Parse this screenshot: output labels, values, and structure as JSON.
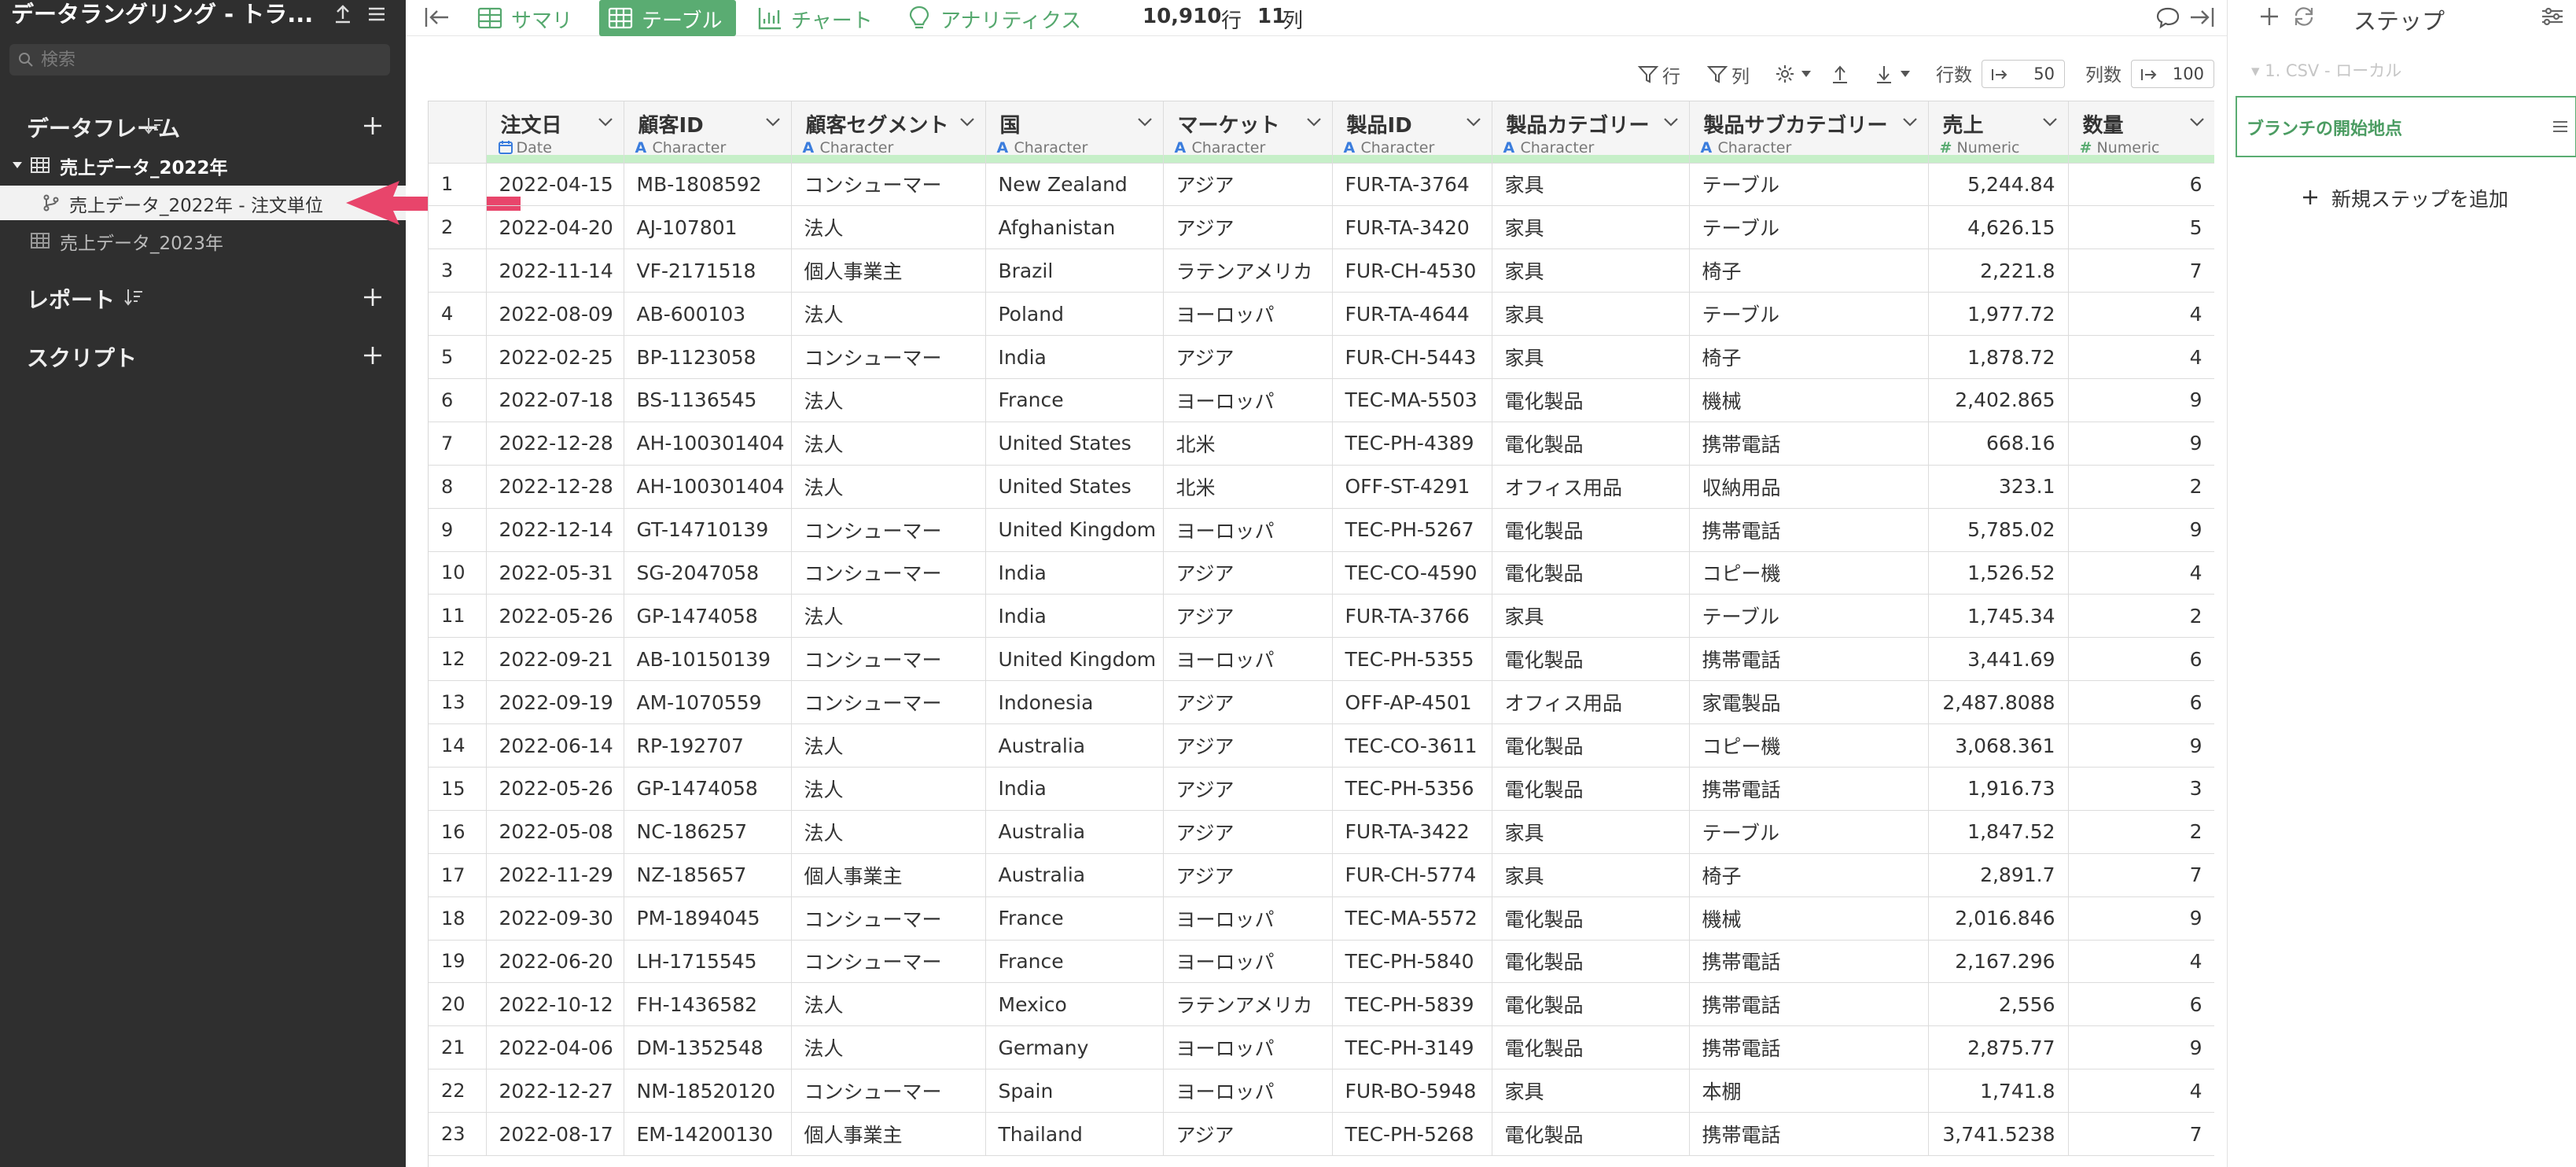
{
  "sidebar": {
    "title": "データラングリング - トラ...",
    "search_placeholder": "検索",
    "sections": {
      "dataframes": "データフレーム",
      "reports": "レポート",
      "scripts": "スクリプト"
    },
    "items": {
      "df1": "売上データ_2022年",
      "branch": "売上データ_2022年 - 注文単位",
      "df2": "売上データ_2023年"
    }
  },
  "topbar": {
    "tabs": {
      "summary": "サマリ",
      "table": "テーブル",
      "chart": "チャート",
      "analytics": "アナリティクス"
    },
    "rows_count": "10,910",
    "rows_unit": "行",
    "cols_count": "11",
    "cols_unit": "列"
  },
  "toolbar": {
    "row_filter": "行",
    "col_filter": "列",
    "rows_label": "行数",
    "rows_value": "50",
    "cols_label": "列数",
    "cols_value": "100"
  },
  "table": {
    "columns": [
      {
        "name": "注文日",
        "type": "Date"
      },
      {
        "name": "顧客ID",
        "type": "Character"
      },
      {
        "name": "顧客セグメント",
        "type": "Character"
      },
      {
        "name": "国",
        "type": "Character"
      },
      {
        "name": "マーケット",
        "type": "Character"
      },
      {
        "name": "製品ID",
        "type": "Character"
      },
      {
        "name": "製品カテゴリー",
        "type": "Character"
      },
      {
        "name": "製品サブカテゴリー",
        "type": "Character"
      },
      {
        "name": "売上",
        "type": "Numeric"
      },
      {
        "name": "数量",
        "type": "Numeric"
      }
    ],
    "rows": [
      [
        "1",
        "2022-04-15",
        "MB-1808592",
        "コンシューマー",
        "New Zealand",
        "アジア",
        "FUR-TA-3764",
        "家具",
        "テーブル",
        "5,244.84",
        "6"
      ],
      [
        "2",
        "2022-04-20",
        "AJ-107801",
        "法人",
        "Afghanistan",
        "アジア",
        "FUR-TA-3420",
        "家具",
        "テーブル",
        "4,626.15",
        "5"
      ],
      [
        "3",
        "2022-11-14",
        "VF-2171518",
        "個人事業主",
        "Brazil",
        "ラテンアメリカ",
        "FUR-CH-4530",
        "家具",
        "椅子",
        "2,221.8",
        "7"
      ],
      [
        "4",
        "2022-08-09",
        "AB-600103",
        "法人",
        "Poland",
        "ヨーロッパ",
        "FUR-TA-4644",
        "家具",
        "テーブル",
        "1,977.72",
        "4"
      ],
      [
        "5",
        "2022-02-25",
        "BP-1123058",
        "コンシューマー",
        "India",
        "アジア",
        "FUR-CH-5443",
        "家具",
        "椅子",
        "1,878.72",
        "4"
      ],
      [
        "6",
        "2022-07-18",
        "BS-1136545",
        "法人",
        "France",
        "ヨーロッパ",
        "TEC-MA-5503",
        "電化製品",
        "機械",
        "2,402.865",
        "9"
      ],
      [
        "7",
        "2022-12-28",
        "AH-100301404",
        "法人",
        "United States",
        "北米",
        "TEC-PH-4389",
        "電化製品",
        "携帯電話",
        "668.16",
        "9"
      ],
      [
        "8",
        "2022-12-28",
        "AH-100301404",
        "法人",
        "United States",
        "北米",
        "OFF-ST-4291",
        "オフィス用品",
        "収納用品",
        "323.1",
        "2"
      ],
      [
        "9",
        "2022-12-14",
        "GT-14710139",
        "コンシューマー",
        "United Kingdom",
        "ヨーロッパ",
        "TEC-PH-5267",
        "電化製品",
        "携帯電話",
        "5,785.02",
        "9"
      ],
      [
        "10",
        "2022-05-31",
        "SG-2047058",
        "コンシューマー",
        "India",
        "アジア",
        "TEC-CO-4590",
        "電化製品",
        "コピー機",
        "1,526.52",
        "4"
      ],
      [
        "11",
        "2022-05-26",
        "GP-1474058",
        "法人",
        "India",
        "アジア",
        "FUR-TA-3766",
        "家具",
        "テーブル",
        "1,745.34",
        "2"
      ],
      [
        "12",
        "2022-09-21",
        "AB-10150139",
        "コンシューマー",
        "United Kingdom",
        "ヨーロッパ",
        "TEC-PH-5355",
        "電化製品",
        "携帯電話",
        "3,441.69",
        "6"
      ],
      [
        "13",
        "2022-09-19",
        "AM-1070559",
        "コンシューマー",
        "Indonesia",
        "アジア",
        "OFF-AP-4501",
        "オフィス用品",
        "家電製品",
        "2,487.8088",
        "6"
      ],
      [
        "14",
        "2022-06-14",
        "RP-192707",
        "法人",
        "Australia",
        "アジア",
        "TEC-CO-3611",
        "電化製品",
        "コピー機",
        "3,068.361",
        "9"
      ],
      [
        "15",
        "2022-05-26",
        "GP-1474058",
        "法人",
        "India",
        "アジア",
        "TEC-PH-5356",
        "電化製品",
        "携帯電話",
        "1,916.73",
        "3"
      ],
      [
        "16",
        "2022-05-08",
        "NC-186257",
        "法人",
        "Australia",
        "アジア",
        "FUR-TA-3422",
        "家具",
        "テーブル",
        "1,847.52",
        "2"
      ],
      [
        "17",
        "2022-11-29",
        "NZ-185657",
        "個人事業主",
        "Australia",
        "アジア",
        "FUR-CH-5774",
        "家具",
        "椅子",
        "2,891.7",
        "7"
      ],
      [
        "18",
        "2022-09-30",
        "PM-1894045",
        "コンシューマー",
        "France",
        "ヨーロッパ",
        "TEC-MA-5572",
        "電化製品",
        "機械",
        "2,016.846",
        "9"
      ],
      [
        "19",
        "2022-06-20",
        "LH-1715545",
        "コンシューマー",
        "France",
        "ヨーロッパ",
        "TEC-PH-5840",
        "電化製品",
        "携帯電話",
        "2,167.296",
        "4"
      ],
      [
        "20",
        "2022-10-12",
        "FH-1436582",
        "法人",
        "Mexico",
        "ラテンアメリカ",
        "TEC-PH-5839",
        "電化製品",
        "携帯電話",
        "2,556",
        "6"
      ],
      [
        "21",
        "2022-04-06",
        "DM-1352548",
        "法人",
        "Germany",
        "ヨーロッパ",
        "TEC-PH-3149",
        "電化製品",
        "携帯電話",
        "2,875.77",
        "9"
      ],
      [
        "22",
        "2022-12-27",
        "NM-18520120",
        "コンシューマー",
        "Spain",
        "ヨーロッパ",
        "FUR-BO-5948",
        "家具",
        "本棚",
        "1,741.8",
        "4"
      ],
      [
        "23",
        "2022-08-17",
        "EM-14200130",
        "個人事業主",
        "Thailand",
        "アジア",
        "TEC-PH-5268",
        "電化製品",
        "携帯電話",
        "3,741.5238",
        "7"
      ]
    ]
  },
  "steps": {
    "title": "ステップ",
    "source_step": "1. CSV - ローカル",
    "branch_step": "ブランチの開始地点",
    "add_step": "新規ステップを追加"
  },
  "colors": {
    "accent": "#5aac72",
    "sidebar_bg": "#2f2f2f",
    "arrow": "#e8456b",
    "quality_bar": "#c6efc8"
  }
}
